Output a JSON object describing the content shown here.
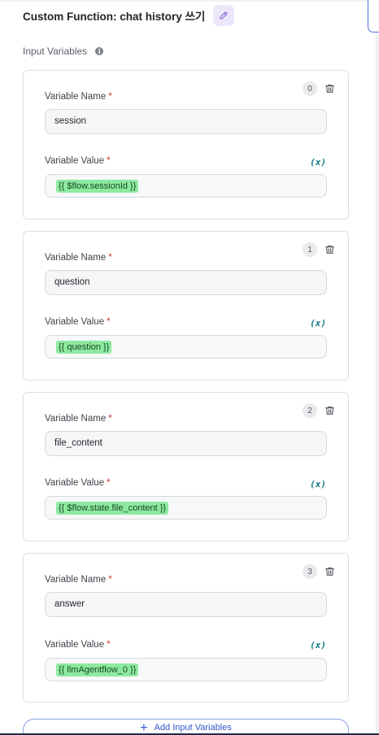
{
  "header": {
    "title": "Custom Function: chat history 쓰기"
  },
  "section": {
    "label": "Input Variables"
  },
  "labels": {
    "variable_name": "Variable Name",
    "variable_value": "Variable Value",
    "required_mark": "*",
    "var_icon": "(x)"
  },
  "variables": [
    {
      "index": "0",
      "name": "session",
      "value": "{{ $flow.sessionId }}"
    },
    {
      "index": "1",
      "name": "question",
      "value": "{{ question }}"
    },
    {
      "index": "2",
      "name": "file_content",
      "value": "{{ $flow.state.file_content }}"
    },
    {
      "index": "3",
      "name": "answer",
      "value": "{{ llmAgentflow_0 }}"
    }
  ],
  "add_button": {
    "label": "Add Input Variables"
  },
  "icons": {
    "edit": "pencil-icon",
    "info": "info-icon",
    "delete": "trash-icon",
    "add": "plus-icon"
  },
  "colors": {
    "chip_background": "#8ee9a0",
    "accent": "#3457c8",
    "variable_icon": "#137a86",
    "required": "#d32f2f",
    "edit_button_background": "#ece7fb"
  }
}
